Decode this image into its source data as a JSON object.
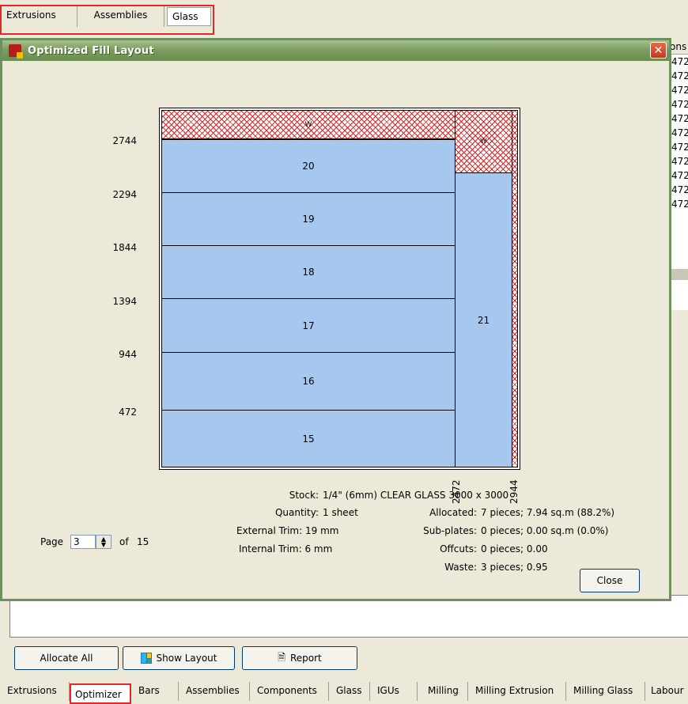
{
  "top_tabs": [
    "Extrusions",
    "Assemblies",
    "Glass"
  ],
  "bg_list": {
    "header": "ons",
    "rows": [
      "472",
      "472",
      "472",
      "472",
      "472",
      "472",
      "472",
      "472",
      "472",
      "472",
      "472"
    ]
  },
  "dialog": {
    "title": "Optimized Fill Layout",
    "close_glyph": "✕",
    "y_ticks": [
      "2744",
      "2294",
      "1844",
      "1394",
      "944",
      "472"
    ],
    "x_ticks": [
      "2472",
      "2944"
    ],
    "pieces": [
      "20",
      "19",
      "18",
      "17",
      "16",
      "15",
      "21"
    ],
    "waste_labels": [
      "W",
      "W"
    ],
    "info": {
      "stock_label": "Stock:",
      "stock_value": "1/4\" (6mm) CLEAR GLASS 3000 x 3000",
      "quantity_label": "Quantity:",
      "quantity_value": "1 sheet",
      "external_trim": "External Trim: 19 mm",
      "internal_trim": "Internal Trim: 6 mm",
      "allocated_label": "Allocated:",
      "allocated_value": "7 pieces; 7.94  sq.m (88.2%)",
      "subplates_label": "Sub-plates:",
      "subplates_value": "0 pieces; 0.00  sq.m (0.0%)",
      "offcuts_label": "Offcuts:",
      "offcuts_value": "0 pieces; 0.00",
      "waste_label": "Waste:",
      "waste_value": "3 pieces; 0.95"
    },
    "page": {
      "label": "Page",
      "value": "3",
      "of_label": "of",
      "total": "15"
    },
    "close_label": "Close"
  },
  "buttons": {
    "allocate_all": "Allocate All",
    "show_layout": "Show Layout",
    "report": "Report"
  },
  "bottom_tabs": [
    "Extrusions",
    "Optimizer",
    "Bars",
    "Assemblies",
    "Components",
    "Glass",
    "IGUs",
    "Milling",
    "Milling Extrusion",
    "Milling Glass",
    "Labour"
  ]
}
